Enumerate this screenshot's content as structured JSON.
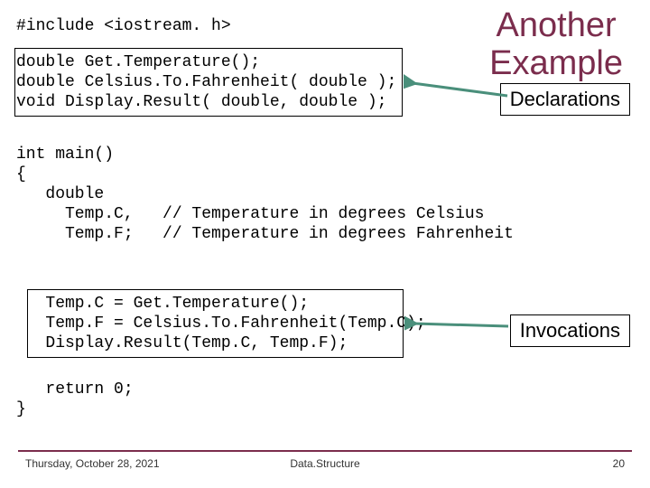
{
  "title_line1": "Another",
  "title_line2": "Example",
  "labels": {
    "declarations": "Declarations",
    "invocations": "Invocations"
  },
  "code": {
    "include": "#include <iostream. h>",
    "decl1": "double Get.Temperature();",
    "decl2": "double Celsius.To.Fahrenheit( double );",
    "decl3": "void Display.Result( double, double );",
    "main1": "int main()",
    "main2": "{",
    "v1": "   double",
    "v2": "     Temp.C,   // Temperature in degrees Celsius",
    "v3": "     Temp.F;   // Temperature in degrees Fahrenheit",
    "inv1": "   Temp.C = Get.Temperature();",
    "inv2": "   Temp.F = Celsius.To.Fahrenheit(Temp.C);",
    "inv3": "   Display.Result(Temp.C, Temp.F);",
    "ret": "   return 0;",
    "end": "}"
  },
  "footer": {
    "date": "Thursday, October 28, 2021",
    "center": "Data.Structure",
    "page": "20"
  },
  "colors": {
    "accent": "#7b2d4d",
    "arrow": "#4a8f7b"
  }
}
